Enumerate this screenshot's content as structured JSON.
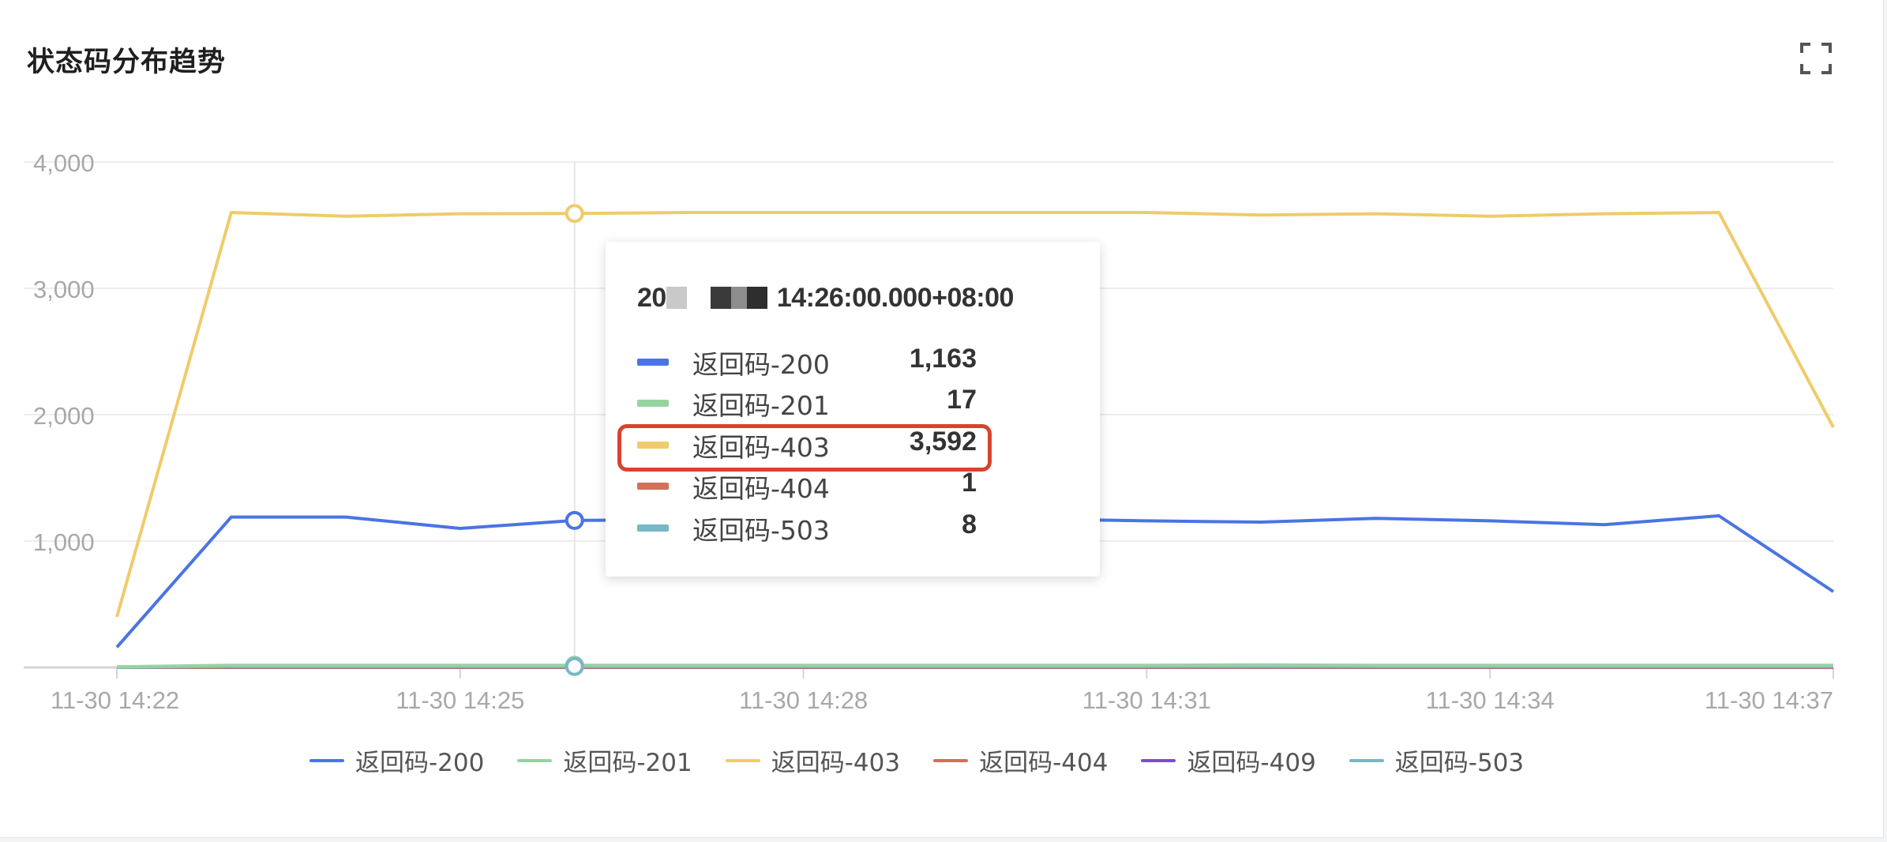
{
  "panel": {
    "title": "状态码分布趋势"
  },
  "tooltip": {
    "time_prefix": "20",
    "time_suffix": "14:26:00.000+08:00",
    "rows": [
      {
        "name": "返回码-200",
        "value": "1,163",
        "color": "#4a74e3"
      },
      {
        "name": "返回码-201",
        "value": "17",
        "color": "#97d3a1"
      },
      {
        "name": "返回码-403",
        "value": "3,592",
        "color": "#efcb6b",
        "highlighted": true
      },
      {
        "name": "返回码-404",
        "value": "1",
        "color": "#d2705a"
      },
      {
        "name": "返回码-503",
        "value": "8",
        "color": "#78b8c4"
      }
    ]
  },
  "chart_data": {
    "type": "line",
    "x": [
      "11-30 14:22",
      "11-30 14:23",
      "11-30 14:24",
      "11-30 14:25",
      "11-30 14:26",
      "11-30 14:27",
      "11-30 14:28",
      "11-30 14:29",
      "11-30 14:30",
      "11-30 14:31",
      "11-30 14:32",
      "11-30 14:33",
      "11-30 14:34",
      "11-30 14:35",
      "11-30 14:36",
      "11-30 14:37"
    ],
    "x_ticks": [
      "11-30 14:22",
      "11-30 14:25",
      "11-30 14:28",
      "11-30 14:31",
      "11-30 14:34",
      "11-30 14:37"
    ],
    "y_ticks": [
      "4,000",
      "3,000",
      "2,000",
      "1,000"
    ],
    "ylim": [
      0,
      4000
    ],
    "grid": true,
    "legend_position": "bottom",
    "hover_index": 4,
    "series": [
      {
        "name": "返回码-200",
        "color": "#4a74e3",
        "values": [
          160,
          1190,
          1190,
          1100,
          1163,
          1170,
          1170,
          1170,
          1175,
          1160,
          1150,
          1180,
          1160,
          1130,
          1200,
          600
        ]
      },
      {
        "name": "返回码-201",
        "color": "#97d3a1",
        "values": [
          5,
          17,
          17,
          17,
          17,
          17,
          17,
          17,
          17,
          17,
          20,
          17,
          17,
          17,
          17,
          17
        ]
      },
      {
        "name": "返回码-403",
        "color": "#efcb6b",
        "values": [
          400,
          3600,
          3570,
          3590,
          3592,
          3600,
          3600,
          3600,
          3600,
          3600,
          3580,
          3590,
          3570,
          3590,
          3600,
          1900
        ]
      },
      {
        "name": "返回码-404",
        "color": "#d2705a",
        "values": [
          0,
          1,
          1,
          1,
          1,
          1,
          1,
          1,
          1,
          1,
          1,
          1,
          1,
          1,
          1,
          1
        ]
      },
      {
        "name": "返回码-409",
        "color": "#7a4fc9",
        "values": [
          0,
          0,
          0,
          0,
          0,
          0,
          0,
          0,
          0,
          0,
          0,
          0,
          0,
          0,
          0,
          0
        ]
      },
      {
        "name": "返回码-503",
        "color": "#78b8c4",
        "values": [
          0,
          8,
          8,
          8,
          8,
          8,
          8,
          8,
          8,
          8,
          8,
          8,
          8,
          8,
          8,
          8
        ]
      }
    ]
  }
}
